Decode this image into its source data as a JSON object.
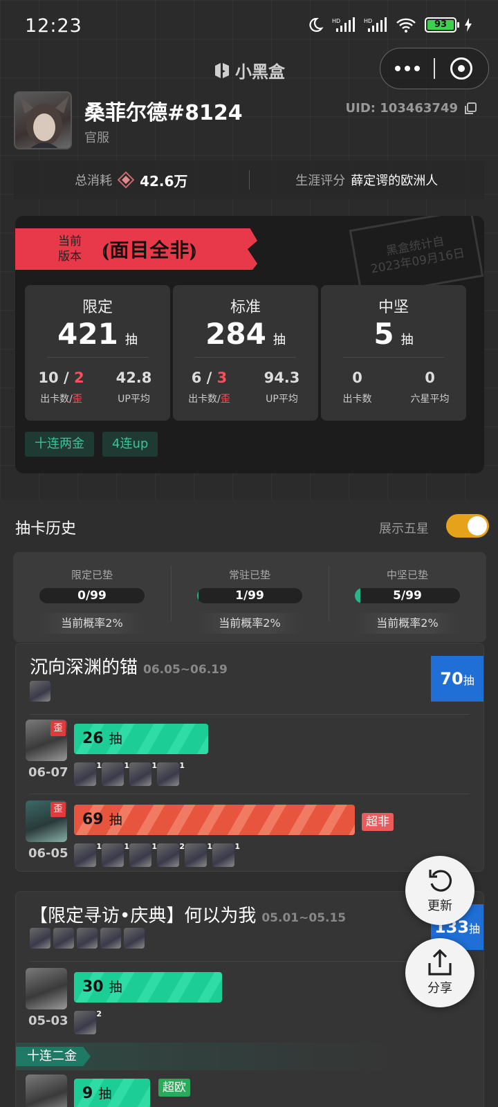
{
  "status": {
    "time": "12:23",
    "battery": "93"
  },
  "nav": {
    "title": "小黑盒"
  },
  "profile": {
    "name": "桑菲尔德#8124",
    "server": "官服",
    "uid": "UID: 103463749"
  },
  "summary": {
    "spend_label": "总消耗",
    "spend_value": "42.6万",
    "rating_label": "生涯评分",
    "rating_value": "薛定谔的欧洲人"
  },
  "stats": {
    "stamp_line1": "黑盒统计自",
    "stamp_line2": "2023年09月16日",
    "banner_small1": "当前",
    "banner_small2": "版本",
    "banner_title": "面目全非",
    "pull_unit": "抽",
    "pools": [
      {
        "name": "限定",
        "count": "421",
        "left_num": "10 / ",
        "left_red": "2",
        "left_label": "出卡数/",
        "left_label_red": "歪",
        "right_num": "42.8",
        "right_label": "UP平均"
      },
      {
        "name": "标准",
        "count": "284",
        "left_num": "6 / ",
        "left_red": "3",
        "left_label": "出卡数/",
        "left_label_red": "歪",
        "right_num": "94.3",
        "right_label": "UP平均"
      },
      {
        "name": "中坚",
        "count": "5",
        "left_num": "0",
        "left_red": "",
        "left_label": "出卡数",
        "left_label_red": "",
        "right_num": "0",
        "right_label": "六星平均"
      }
    ],
    "tags": [
      "十连两金",
      "4连up"
    ]
  },
  "history": {
    "title": "抽卡历史",
    "toggle_label": "展示五星",
    "toggle_on": true,
    "pity": [
      {
        "label": "限定已垫",
        "value": "0/99",
        "fraction": 0.0,
        "prob": "当前概率2%"
      },
      {
        "label": "常驻已垫",
        "value": "1/99",
        "fraction": 0.0101,
        "prob": "当前概率2%"
      },
      {
        "label": "中坚已垫",
        "value": "5/99",
        "fraction": 0.0505,
        "prob": "当前概率2%"
      }
    ],
    "pool1": {
      "title": "沉向深渊的锚",
      "date": "06.05~06.19",
      "total": "70",
      "total_unit": "抽",
      "pulls": [
        {
          "date": "06-07",
          "count": "26",
          "unit": "抽",
          "badge": "歪",
          "fill": 0.26,
          "chars": [
            "1",
            "1",
            "1",
            "1"
          ],
          "tag": ""
        },
        {
          "date": "06-05",
          "count": "69",
          "unit": "抽",
          "badge": "歪",
          "fill": 0.69,
          "chars": [
            "1",
            "1",
            "1",
            "2",
            "1",
            "1"
          ],
          "tag": "超非"
        }
      ]
    },
    "pool2": {
      "title": "【限定寻访•庆典】何以为我",
      "date": "05.01~05.15",
      "total": "133",
      "total_unit": "抽",
      "pulls": [
        {
          "date": "05-03",
          "count": "30",
          "unit": "抽",
          "fill": 0.3,
          "chars": [
            "2"
          ]
        },
        {
          "count": "9",
          "unit": "抽",
          "tag": "超欧"
        }
      ],
      "ten_tag": "十连二金"
    }
  },
  "buttons": {
    "refresh": "更新",
    "share": "分享"
  }
}
